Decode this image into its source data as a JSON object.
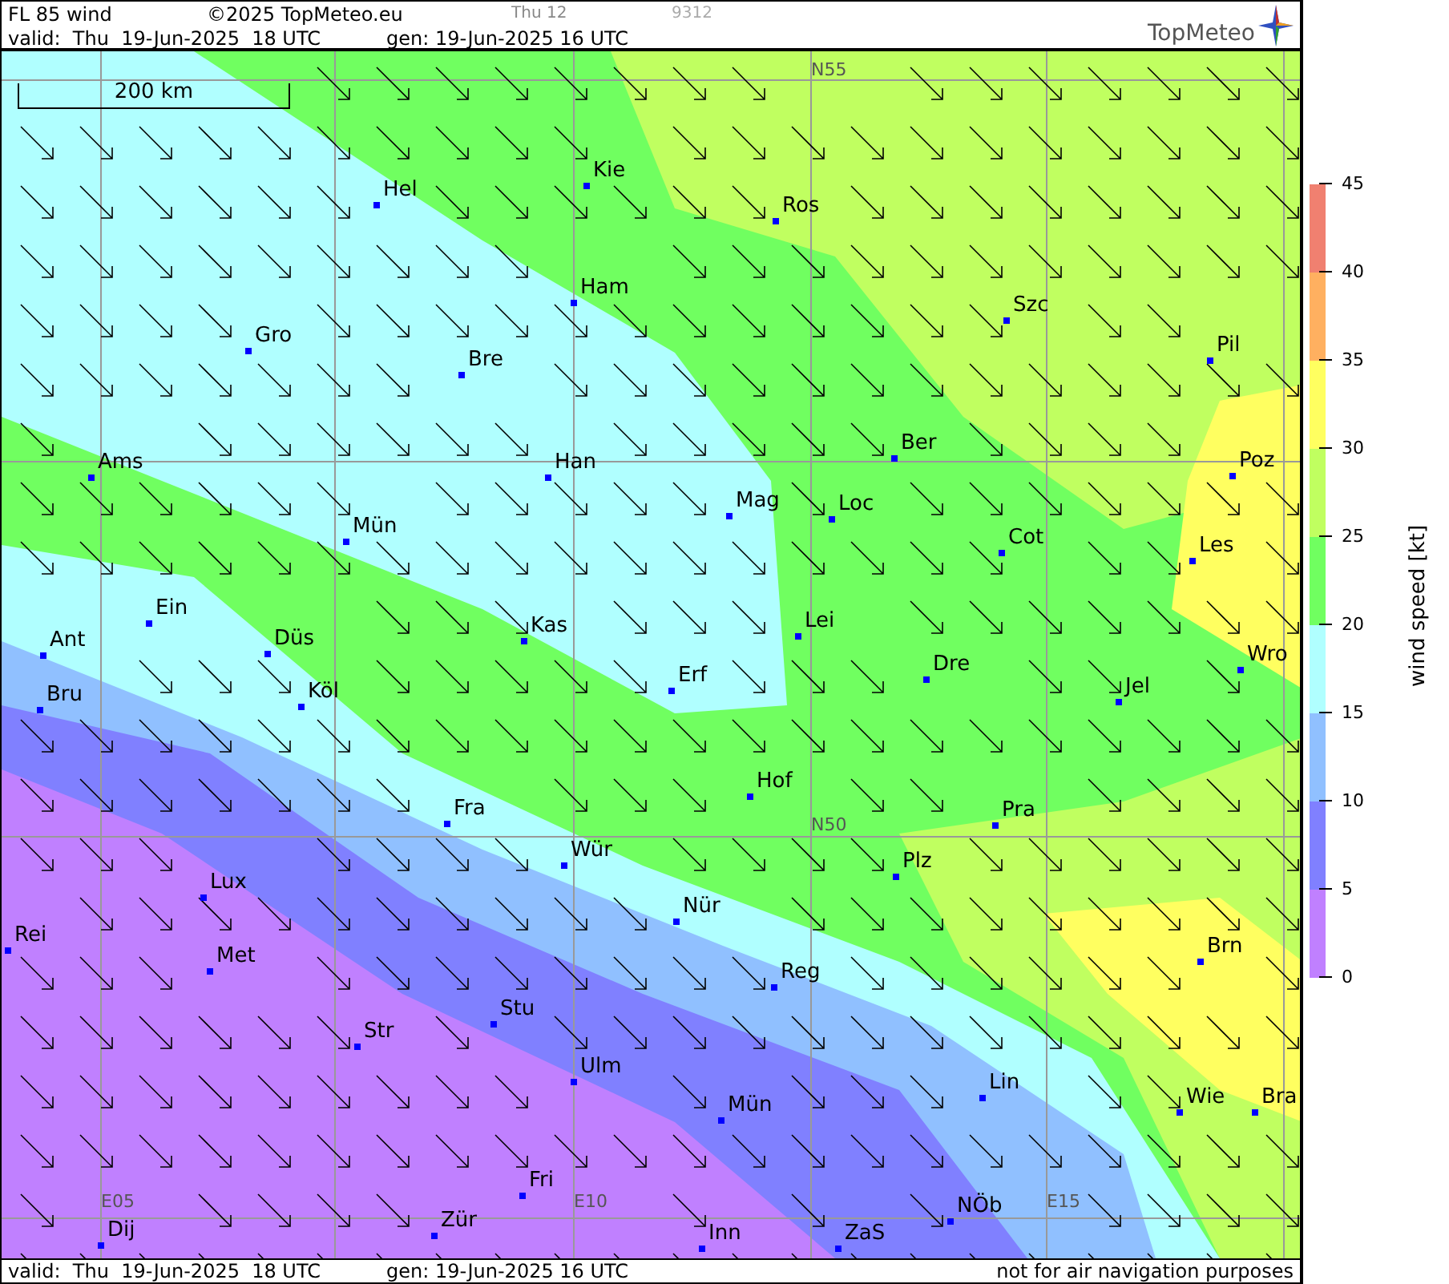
{
  "header": {
    "title": "FL 85 wind",
    "copyright": "©2025 TopMeteo.eu",
    "day_hour": "Thu 12",
    "code": "9312",
    "valid": "valid:  Thu  19-Jun-2025  18 UTC",
    "generated": "gen: 19-Jun-2025 16 UTC",
    "logo": "TopMeteo"
  },
  "map": {
    "scale": "200 km",
    "grid_labels": [
      "N55",
      "N50",
      "E05",
      "E10",
      "E15"
    ],
    "cities": [
      "Hel",
      "Kie",
      "Ros",
      "Ham",
      "Szc",
      "Gro",
      "Bre",
      "Pil",
      "Ber",
      "Ams",
      "Han",
      "Poz",
      "Mag",
      "Loc",
      "Cot",
      "Les",
      "Mün",
      "Ein",
      "Lei",
      "Ant",
      "Düs",
      "Kas",
      "Wro",
      "Dre",
      "Bru",
      "Köl",
      "Erf",
      "Jel",
      "Hof",
      "Pra",
      "Fra",
      "Wür",
      "Plz",
      "Lux",
      "Nür",
      "Rei",
      "Met",
      "Reg",
      "Brn",
      "Stu",
      "Str",
      "Ulm",
      "Lin",
      "Wie",
      "Bra",
      "Mün",
      "Fri",
      "NÖb",
      "Dij",
      "Zür",
      "Inn",
      "ZaS"
    ]
  },
  "legend": {
    "title": "wind speed [kt]",
    "ticks": [
      "45",
      "40",
      "35",
      "30",
      "25",
      "20",
      "15",
      "10",
      "5",
      "0"
    ],
    "bands": [
      {
        "color": "#f08070"
      },
      {
        "color": "#ffb060"
      },
      {
        "color": "#ffff60"
      },
      {
        "color": "#c0ff60"
      },
      {
        "color": "#70ff60"
      },
      {
        "color": "#b0ffff"
      },
      {
        "color": "#90c0ff"
      },
      {
        "color": "#8080ff"
      },
      {
        "color": "#c080ff"
      }
    ]
  },
  "footer": {
    "valid": "valid:  Thu  19-Jun-2025  18 UTC",
    "generated": "gen: 19-Jun-2025 16 UTC",
    "note": "not for air navigation purposes"
  }
}
